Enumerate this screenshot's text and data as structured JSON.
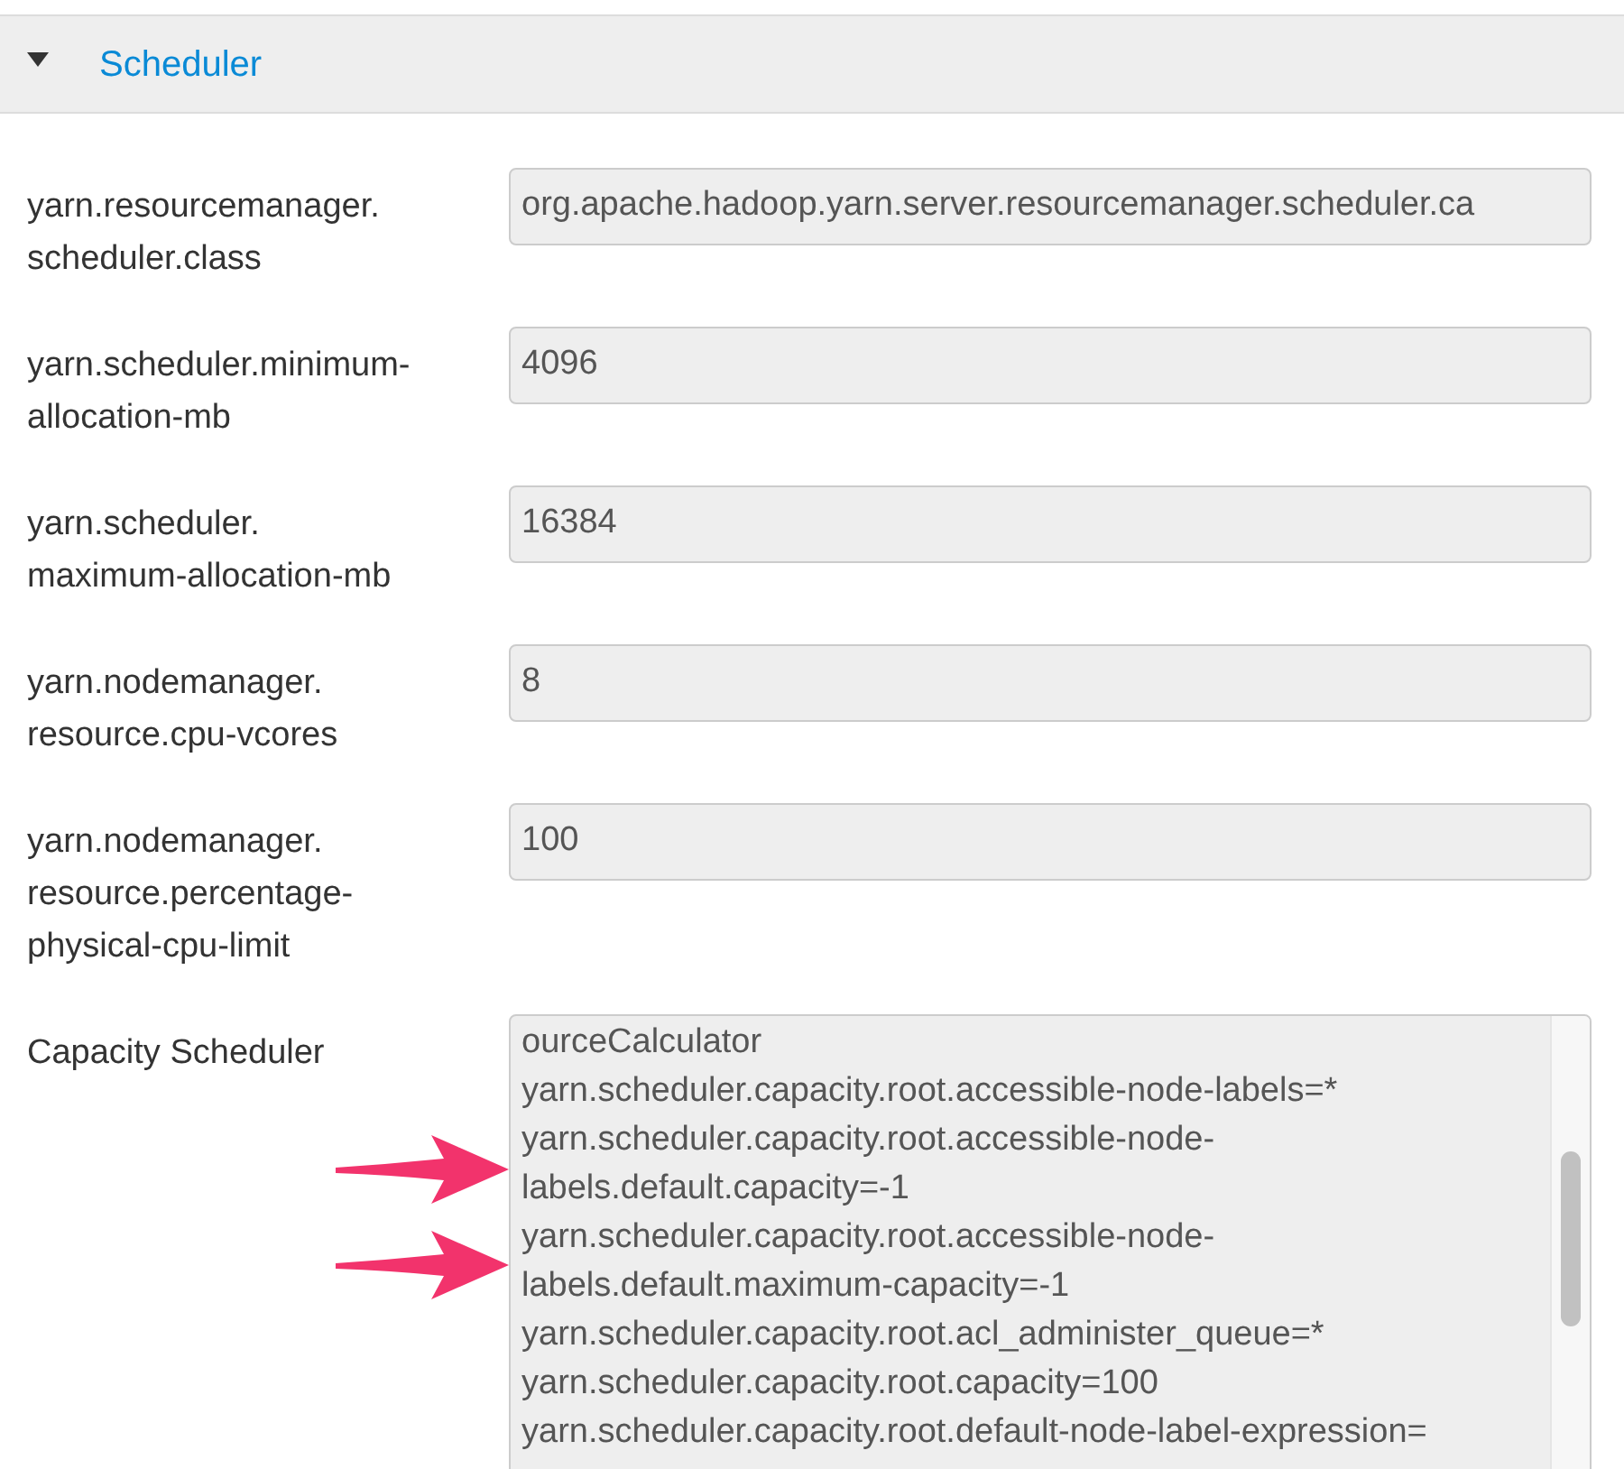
{
  "section": {
    "title": "Scheduler",
    "expanded": true
  },
  "fields": [
    {
      "label_lines": [
        "yarn.resourcemanager.",
        "scheduler.class"
      ],
      "value": "org.apache.hadoop.yarn.server.resourcemanager.scheduler.ca"
    },
    {
      "label_lines": [
        "yarn.scheduler.minimum-",
        "allocation-mb"
      ],
      "value": "4096"
    },
    {
      "label_lines": [
        "yarn.scheduler.",
        "maximum-allocation-mb"
      ],
      "value": "16384"
    },
    {
      "label_lines": [
        "yarn.nodemanager.",
        "resource.cpu-vcores"
      ],
      "value": "8"
    },
    {
      "label_lines": [
        "yarn.nodemanager.",
        "resource.percentage-",
        "physical-cpu-limit"
      ],
      "value": "100"
    }
  ],
  "capacity_scheduler": {
    "label": "Capacity Scheduler",
    "lines": [
      "ourceCalculator",
      "yarn.scheduler.capacity.root.accessible-node-labels=*",
      "yarn.scheduler.capacity.root.accessible-node-",
      "labels.default.capacity=-1",
      "yarn.scheduler.capacity.root.accessible-node-",
      "labels.default.maximum-capacity=-1",
      "yarn.scheduler.capacity.root.acl_administer_queue=*",
      "yarn.scheduler.capacity.root.capacity=100",
      "yarn.scheduler.capacity.root.default-node-label-expression="
    ]
  }
}
